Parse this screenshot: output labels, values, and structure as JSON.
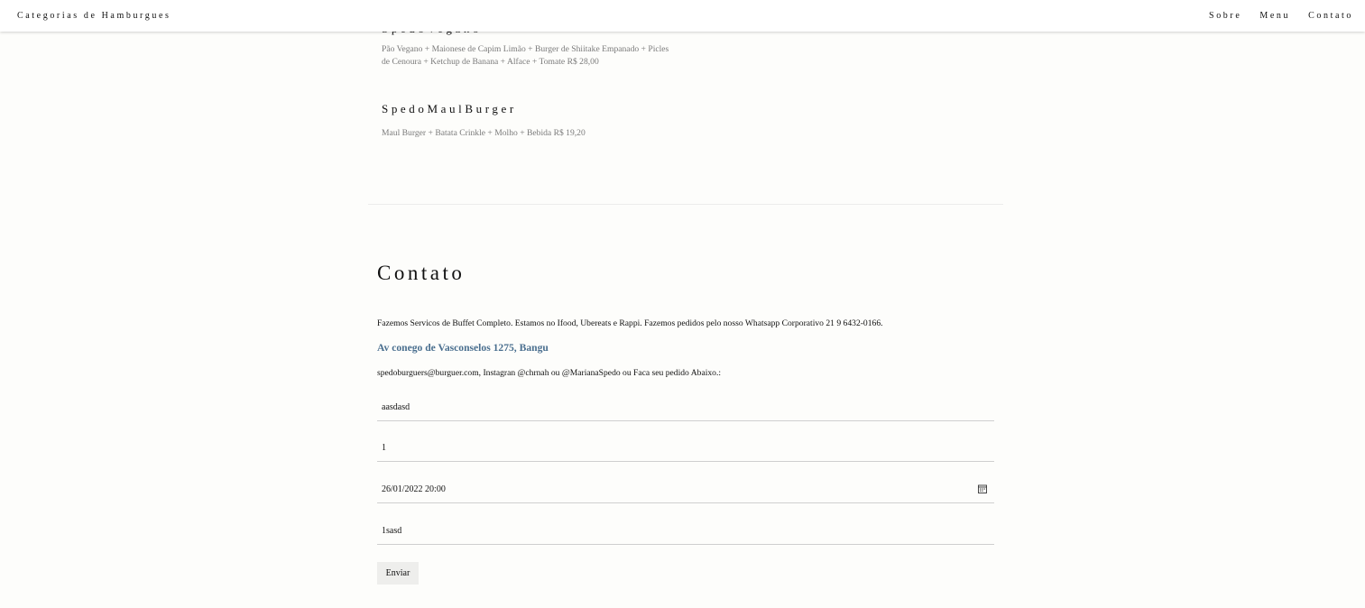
{
  "header": {
    "brand": "Categorias de Hamburgues",
    "nav": [
      "Sobre",
      "Menu",
      "Contato"
    ]
  },
  "menu": {
    "items": [
      {
        "name": "SpedoVegano",
        "description_line1": "Pão Vegano + Maionese de Capim Limão + Burger de Shiitake Empanado + Picles",
        "description_line2": "de Cenoura + Ketchup de Banana + Alface + Tomate R$ 28,00"
      },
      {
        "name": "SpedoMaulBurger",
        "description": "Maul Burger + Batata Crinkle + Molho + Bebida R$ 19,20"
      }
    ]
  },
  "contact": {
    "title": "Contato",
    "text": "Fazemos Servicos de Buffet Completo. Estamos no Ifood, Ubereats e Rappi. Fazemos pedidos pelo nosso Whatsapp Corporativo 21 9 6432-0166.",
    "address": "Av conego de Vasconselos 1275, Bangu",
    "email_text": "spedoburguers@burguer.com, Instagran @chrnah ou @MarianaSpedo ou Faca seu pedido Abaixo.:",
    "form": {
      "name_value": "aasdasd",
      "people_value": "1",
      "datetime_value": "26/01/2022 20:00",
      "message_value": "1sasd",
      "submit_label": "Enviar"
    }
  },
  "icons": {
    "calendar": "calendar-icon"
  },
  "colors": {
    "background": "#fdfdfb",
    "address": "#4a6f8f",
    "button_bg": "#eeeeec"
  }
}
